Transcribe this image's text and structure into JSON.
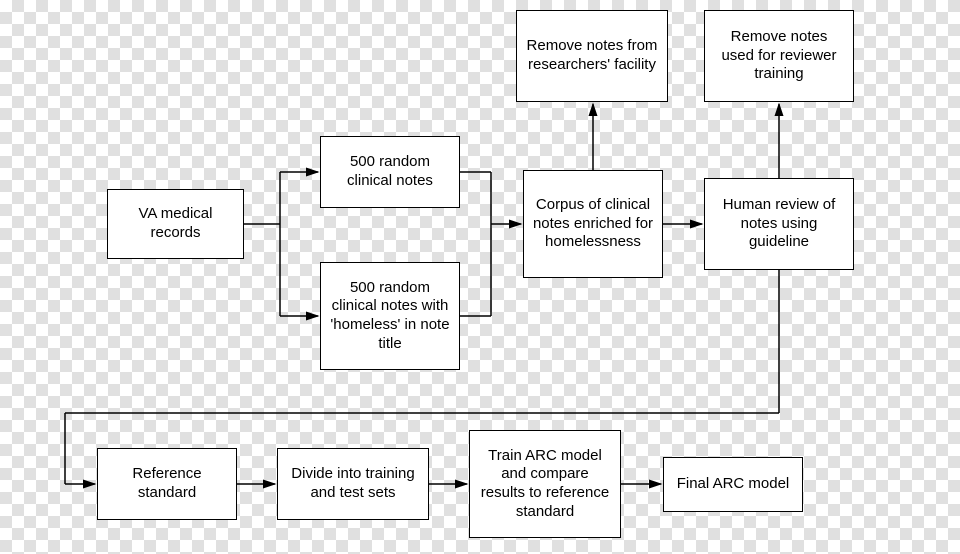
{
  "boxes": {
    "va": "VA medical records",
    "random500": "500 random clinical notes",
    "random500homeless": "500 random clinical notes with 'homeless' in note title",
    "corpus": "Corpus of clinical notes enriched for homelessness",
    "removeFacility": "Remove notes from researchers' facility",
    "humanReview": "Human review of notes using guideline",
    "removeReviewer": "Remove notes used for reviewer training",
    "refStandard": "Reference standard",
    "divide": "Divide into training and test sets",
    "trainArc": "Train ARC model and compare results to reference standard",
    "finalArc": "Final ARC model"
  }
}
